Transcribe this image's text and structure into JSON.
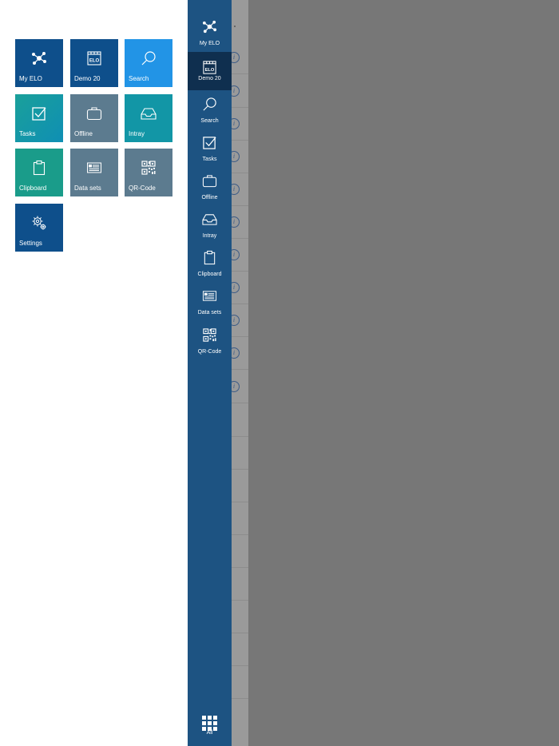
{
  "tiles": [
    {
      "label": "My ELO",
      "icon": "network-icon",
      "color": "#0e4f8b"
    },
    {
      "label": "Demo 20",
      "icon": "elo-archive-icon",
      "color": "#0e4f8b"
    },
    {
      "label": "Search",
      "icon": "search-icon",
      "color": "#2294e6"
    },
    {
      "label": "Tasks",
      "icon": "checkbox-icon",
      "color": "#1296a6"
    },
    {
      "label": "Offline",
      "icon": "briefcase-icon",
      "color": "#5c7b8f"
    },
    {
      "label": "Intray",
      "icon": "inbox-icon",
      "color": "#1296a6"
    },
    {
      "label": "Clipboard",
      "icon": "clipboard-icon",
      "color": "#1a9c8a"
    },
    {
      "label": "Data sets",
      "icon": "data-sets-icon",
      "color": "#5c7b8f"
    },
    {
      "label": "QR-Code",
      "icon": "qr-code-icon",
      "color": "#5c7b8f"
    },
    {
      "label": "Settings",
      "icon": "settings-gear-icon",
      "color": "#0e4f8b"
    }
  ],
  "rail": {
    "items": [
      {
        "label": "My ELO",
        "icon": "network-icon",
        "active": false
      },
      {
        "label": "Demo 20",
        "icon": "elo-archive-icon",
        "active": true
      },
      {
        "label": "Search",
        "icon": "search-icon",
        "active": false
      },
      {
        "label": "Tasks",
        "icon": "checkbox-icon",
        "active": false
      },
      {
        "label": "Offline",
        "icon": "briefcase-icon",
        "active": false
      },
      {
        "label": "Intray",
        "icon": "inbox-icon",
        "active": false
      },
      {
        "label": "Clipboard",
        "icon": "clipboard-icon",
        "active": false
      },
      {
        "label": "Data sets",
        "icon": "data-sets-icon",
        "active": false
      },
      {
        "label": "QR-Code",
        "icon": "qr-code-icon",
        "active": false
      }
    ],
    "all_label": "All",
    "background": "#1d5382",
    "active_background": "#0f2f4f"
  },
  "overlay_color": "#777777",
  "background_list": {
    "info_glyph": "i"
  }
}
